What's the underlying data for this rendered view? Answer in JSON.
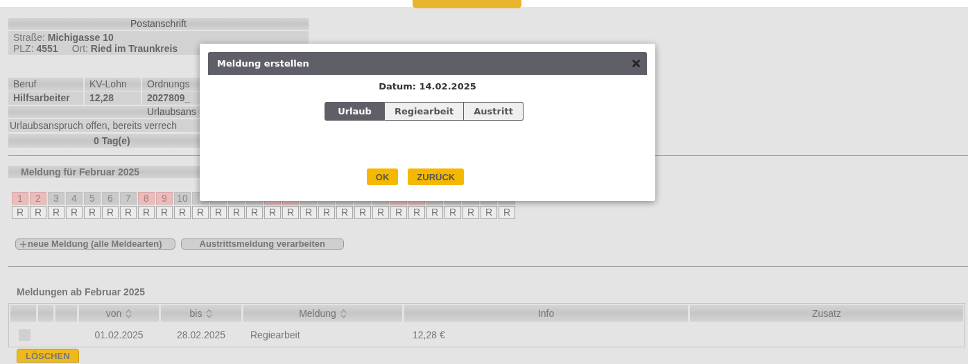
{
  "address": {
    "title": "Postanschrift",
    "street_label": "Straße:",
    "street": "Michigasse 10",
    "plz_label": "PLZ:",
    "plz": "4551",
    "ort_label": "Ort:",
    "ort": "Ried im Traunkreis"
  },
  "job_table": {
    "columns": [
      "Beruf",
      "KV-Lohn",
      "Ordnungs"
    ],
    "row": [
      "Hilfsarbeiter",
      "12,28",
      "2027809_"
    ]
  },
  "vacation": {
    "title": "Urlaubsans",
    "label": "Urlaubsanspruch offen, bereits verrech",
    "value": "0 Tag(e)"
  },
  "month": {
    "title": "Meldung für Februar 2025",
    "days": [
      {
        "label": "1",
        "weekend": true
      },
      {
        "label": "2",
        "weekend": true
      },
      {
        "label": "3",
        "weekend": false
      },
      {
        "label": "4",
        "weekend": false
      },
      {
        "label": "5",
        "weekend": false
      },
      {
        "label": "6",
        "weekend": false
      },
      {
        "label": "7",
        "weekend": false
      },
      {
        "label": "8",
        "weekend": true
      },
      {
        "label": "9",
        "weekend": true
      },
      {
        "label": "10",
        "weekend": false
      },
      {
        "weekend": false
      },
      {
        "weekend": false
      },
      {
        "weekend": false
      },
      {
        "weekend": false
      },
      {
        "weekend": true
      },
      {
        "weekend": true
      },
      {
        "weekend": false
      },
      {
        "weekend": false
      },
      {
        "weekend": false
      },
      {
        "weekend": false
      },
      {
        "weekend": false
      },
      {
        "weekend": true
      },
      {
        "weekend": true
      },
      {
        "weekend": false
      },
      {
        "weekend": false
      },
      {
        "weekend": false
      },
      {
        "weekend": false
      },
      {
        "weekend": false
      }
    ],
    "codes": [
      "R",
      "R",
      "R",
      "R",
      "R",
      "R",
      "R",
      "R",
      "R",
      "R",
      "R",
      "R",
      "R",
      "R",
      "R",
      "R",
      "R",
      "R",
      "R",
      "R",
      "R",
      "R",
      "R",
      "R",
      "R",
      "R",
      "R",
      "R"
    ]
  },
  "buttons": [
    {
      "kind": "add",
      "label": "neue Meldung (alle Meldearten)"
    },
    {
      "kind": "plain",
      "label": "Austrittsmeldung verarbeiten"
    }
  ],
  "reports": {
    "title": "Meldungen ab Februar 2025",
    "columns": [
      {
        "label": "von",
        "sortable": true
      },
      {
        "label": "bis",
        "sortable": true
      },
      {
        "label": "Meldung",
        "sortable": true
      },
      {
        "label": "Info",
        "sortable": false
      },
      {
        "label": "Zusatz",
        "sortable": false
      }
    ],
    "rows": [
      {
        "checked": false,
        "cells": [
          "01.02.2025",
          "28.02.2025",
          "Regiearbeit",
          "12,28 €",
          ""
        ]
      }
    ],
    "delete_button": "LÖSCHEN"
  },
  "dialog": {
    "title": "Meldung erstellen",
    "date": "Datum: 14.02.2025",
    "options": [
      {
        "label": "Urlaub",
        "selected": true
      },
      {
        "label": "Regiearbeit",
        "selected": false
      },
      {
        "label": "Austritt",
        "selected": false
      }
    ],
    "buttons": [
      "OK",
      "ZURÜCK"
    ]
  }
}
